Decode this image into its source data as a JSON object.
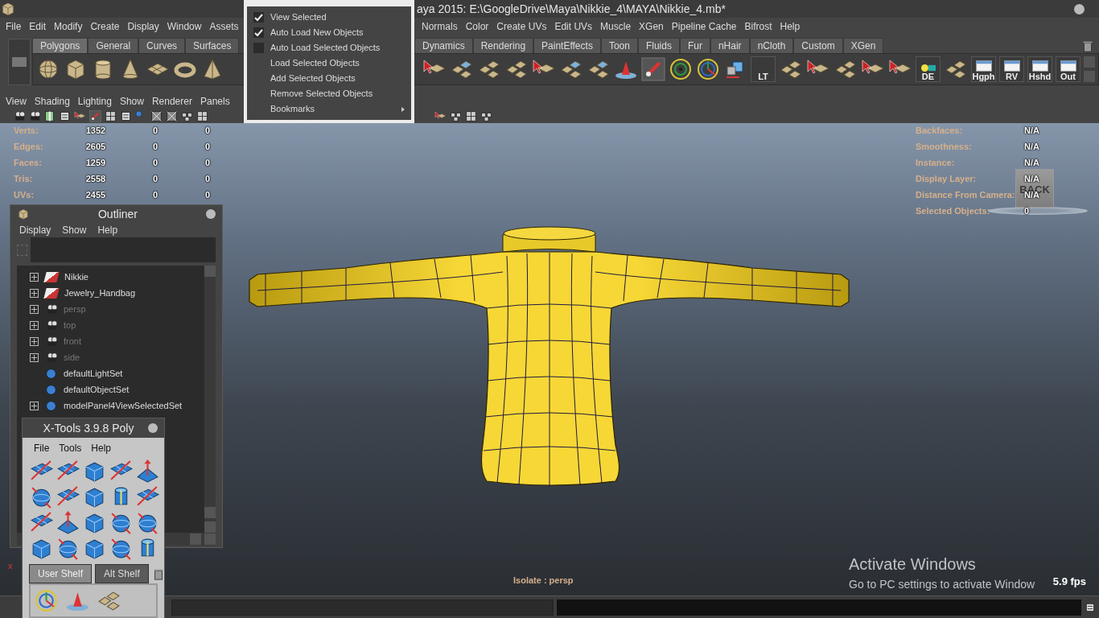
{
  "window": {
    "title": "aya 2015: E:\\GoogleDrive\\Maya\\Nikkie_4\\MAYA\\Nikkie_4.mb*"
  },
  "menu_bar": {
    "left": [
      "File",
      "Edit",
      "Modify",
      "Create",
      "Display",
      "Window",
      "Assets"
    ],
    "right": [
      "Normals",
      "Color",
      "Create UVs",
      "Edit UVs",
      "Muscle",
      "XGen",
      "Pipeline Cache",
      "Bifrost",
      "Help"
    ]
  },
  "shelf": {
    "tabs_left": [
      {
        "label": "Polygons",
        "selected": true
      },
      {
        "label": "General",
        "selected": false
      },
      {
        "label": "Curves",
        "selected": false
      },
      {
        "label": "Surfaces",
        "selected": false
      }
    ],
    "tabs_right": [
      {
        "label": "Dynamics",
        "selected": false
      },
      {
        "label": "Rendering",
        "selected": false
      },
      {
        "label": "PaintEffects",
        "selected": false
      },
      {
        "label": "Toon",
        "selected": false
      },
      {
        "label": "Fluids",
        "selected": false
      },
      {
        "label": "Fur",
        "selected": false
      },
      {
        "label": "nHair",
        "selected": false
      },
      {
        "label": "nCloth",
        "selected": false
      },
      {
        "label": "Custom",
        "selected": false
      },
      {
        "label": "XGen",
        "selected": false
      }
    ],
    "labeled_buttons": [
      "LT",
      "DE",
      "Hgph",
      "RV",
      "Hshd",
      "Out"
    ]
  },
  "isolate_menu": {
    "items": [
      {
        "label": "View Selected",
        "kind": "check",
        "checked": true
      },
      {
        "label": "Auto Load New Objects",
        "kind": "check",
        "checked": true
      },
      {
        "label": "Auto Load Selected Objects",
        "kind": "check",
        "checked": false
      },
      {
        "label": "Load Selected Objects",
        "kind": "action"
      },
      {
        "label": "Add Selected Objects",
        "kind": "action"
      },
      {
        "label": "Remove Selected Objects",
        "kind": "action"
      },
      {
        "label": "Bookmarks",
        "kind": "submenu"
      }
    ]
  },
  "panel_menu": [
    "View",
    "Shading",
    "Lighting",
    "Show",
    "Renderer",
    "Panels"
  ],
  "viewport": {
    "hud_left": [
      {
        "label": "Verts:",
        "values": [
          "1352",
          "0",
          "0"
        ]
      },
      {
        "label": "Edges:",
        "values": [
          "2605",
          "0",
          "0"
        ]
      },
      {
        "label": "Faces:",
        "values": [
          "1259",
          "0",
          "0"
        ]
      },
      {
        "label": "Tris:",
        "values": [
          "2558",
          "0",
          "0"
        ]
      },
      {
        "label": "UVs:",
        "values": [
          "2455",
          "0",
          "0"
        ]
      }
    ],
    "hud_right": [
      {
        "label": "Backfaces:",
        "value": "N/A"
      },
      {
        "label": "Smoothness:",
        "value": "N/A"
      },
      {
        "label": "Instance:",
        "value": "N/A"
      },
      {
        "label": "Display Layer:",
        "value": "N/A"
      },
      {
        "label": "Distance From Camera:",
        "value": "N/A"
      },
      {
        "label": "Selected Objects:",
        "value": "0"
      }
    ],
    "view_cube": "BACK",
    "axis_label": "x",
    "isolate_label": "Isolate : persp",
    "fps": "5.9 fps"
  },
  "activation_notice": {
    "title": "Activate Windows",
    "text": "Go to PC settings to activate Window"
  },
  "outliner": {
    "title": "Outliner",
    "menus": [
      "Display",
      "Show",
      "Help"
    ],
    "items": [
      {
        "label": "Nikkie",
        "kind": "group",
        "expandable": true,
        "dimmed": false
      },
      {
        "label": "Jewelry_Handbag",
        "kind": "group",
        "expandable": true,
        "dimmed": false
      },
      {
        "label": "persp",
        "kind": "camera",
        "expandable": true,
        "dimmed": true
      },
      {
        "label": "top",
        "kind": "camera",
        "expandable": true,
        "dimmed": true
      },
      {
        "label": "front",
        "kind": "camera",
        "expandable": true,
        "dimmed": true
      },
      {
        "label": "side",
        "kind": "camera",
        "expandable": true,
        "dimmed": true
      },
      {
        "label": "defaultLightSet",
        "kind": "set",
        "expandable": false,
        "dimmed": false
      },
      {
        "label": "defaultObjectSet",
        "kind": "set",
        "expandable": false,
        "dimmed": false
      },
      {
        "label": "modelPanel4ViewSelectedSet",
        "kind": "set",
        "expandable": true,
        "dimmed": false
      }
    ]
  },
  "xtools": {
    "title": "X-Tools 3.9.8 Poly",
    "menus": [
      "File",
      "Tools",
      "Help"
    ],
    "tabs": [
      {
        "label": "User Shelf",
        "selected": true
      },
      {
        "label": "Alt Shelf",
        "selected": false
      }
    ]
  }
}
